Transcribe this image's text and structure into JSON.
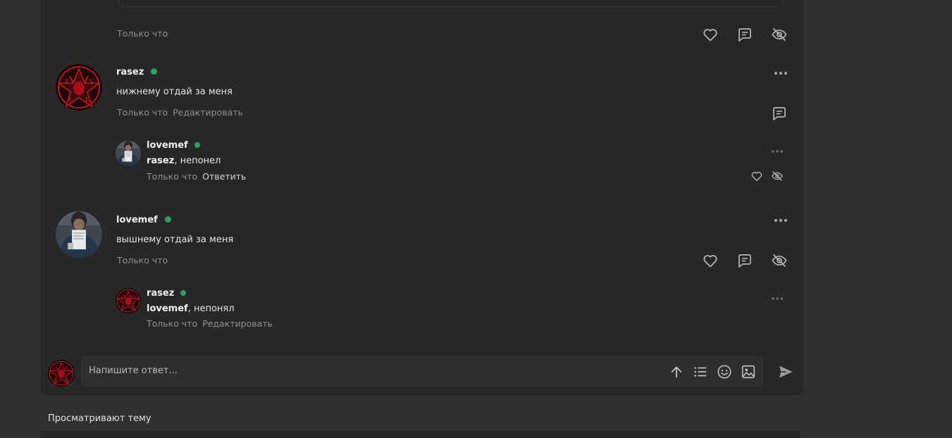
{
  "top_post": {
    "time": "Только что"
  },
  "comments": [
    {
      "author": "rasez",
      "text": "нижнему отдай за меня",
      "time": "Только что",
      "edit_label": "Редактировать",
      "reply": {
        "author": "lovemef",
        "mention": "rasez",
        "text_rest": ", непонел",
        "time": "Только что",
        "reply_label": "Ответить"
      }
    },
    {
      "author": "lovemef",
      "text": "вышнему отдай за меня",
      "time": "Только что",
      "reply": {
        "author": "rasez",
        "mention": "lovemef",
        "text_rest": ", непонял",
        "time": "Только что",
        "edit_label": "Редактировать"
      }
    }
  ],
  "composer": {
    "placeholder": "Напишите ответ..."
  },
  "viewers_label": "Просматривают тему",
  "colors": {
    "online": "#28a35f",
    "pentagram_red": "#c8141e",
    "panel": "#272727"
  },
  "icons": [
    "heart-icon",
    "comment-icon",
    "hide-icon",
    "more-icon",
    "arrow-up-icon",
    "list-icon",
    "smile-icon",
    "image-icon",
    "send-icon"
  ]
}
